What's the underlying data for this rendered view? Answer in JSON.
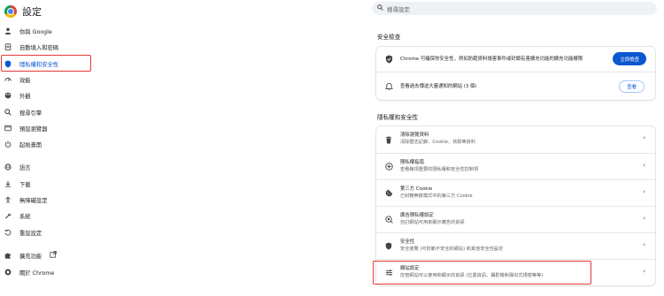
{
  "header": {
    "title": "設定",
    "search_placeholder": "搜尋設定"
  },
  "sidebar": {
    "items": [
      {
        "label": "你與 Google",
        "icon": "person-icon"
      },
      {
        "label": "自動填入和密碼",
        "icon": "clipboard-icon"
      },
      {
        "label": "隱私權和安全性",
        "icon": "shield-icon",
        "active": true
      },
      {
        "label": "效能",
        "icon": "speedometer-icon"
      },
      {
        "label": "外觀",
        "icon": "palette-icon"
      },
      {
        "label": "搜尋引擎",
        "icon": "search-icon"
      },
      {
        "label": "預設瀏覽器",
        "icon": "browser-icon"
      },
      {
        "label": "起始畫面",
        "icon": "power-icon"
      },
      {
        "label": "語言",
        "icon": "globe-icon"
      },
      {
        "label": "下載",
        "icon": "download-icon"
      },
      {
        "label": "無障礙設定",
        "icon": "accessibility-icon"
      },
      {
        "label": "系統",
        "icon": "wrench-icon"
      },
      {
        "label": "重設設定",
        "icon": "reset-icon"
      },
      {
        "label": "擴充功能",
        "icon": "puzzle-icon",
        "external_icon": "open-in-new-icon"
      },
      {
        "label": "關於 Chrome",
        "icon": "chrome-icon"
      }
    ]
  },
  "safety": {
    "section_title": "安全檢查",
    "rows": [
      {
        "title": "Chrome 可確保你安全性，例如防範資料侵害事件或封鎖有害擴充功能的擴充功能權限",
        "button": "立即檢查",
        "icon": "shield-check-icon"
      },
      {
        "title": "查看過去傳送大量通知的網站 (3 個)",
        "button": "查看",
        "icon": "bell-icon"
      }
    ]
  },
  "privacy": {
    "section_title": "隱私權和安全性",
    "rows": [
      {
        "title": "清除瀏覽資料",
        "subtitle": "清除歷史記錄、Cookie、快取等資料",
        "icon": "trash-icon"
      },
      {
        "title": "隱私權指南",
        "subtitle": "查看幾項重要的隱私權和安全性控制項",
        "icon": "plus-circle-icon"
      },
      {
        "title": "第三方 Cookie",
        "subtitle": "已封鎖無痕模式中的第三方 Cookie",
        "icon": "cookie-icon"
      },
      {
        "title": "廣告隱私權設定",
        "subtitle": "自訂網站可用來顯示廣告的資訊",
        "icon": "ad-privacy-icon"
      },
      {
        "title": "安全性",
        "subtitle": "安全瀏覽 (可防範不安全的網站) 和其他安全性設定",
        "icon": "shield-icon"
      },
      {
        "title": "網站設定",
        "subtitle": "控管網站可以使用和顯示的資訊 (位置資訊、攝影機和彈出式視窗等等)",
        "icon": "sliders-icon"
      }
    ]
  },
  "colors": {
    "accent": "#0b57d0",
    "highlight": "#e53935"
  }
}
